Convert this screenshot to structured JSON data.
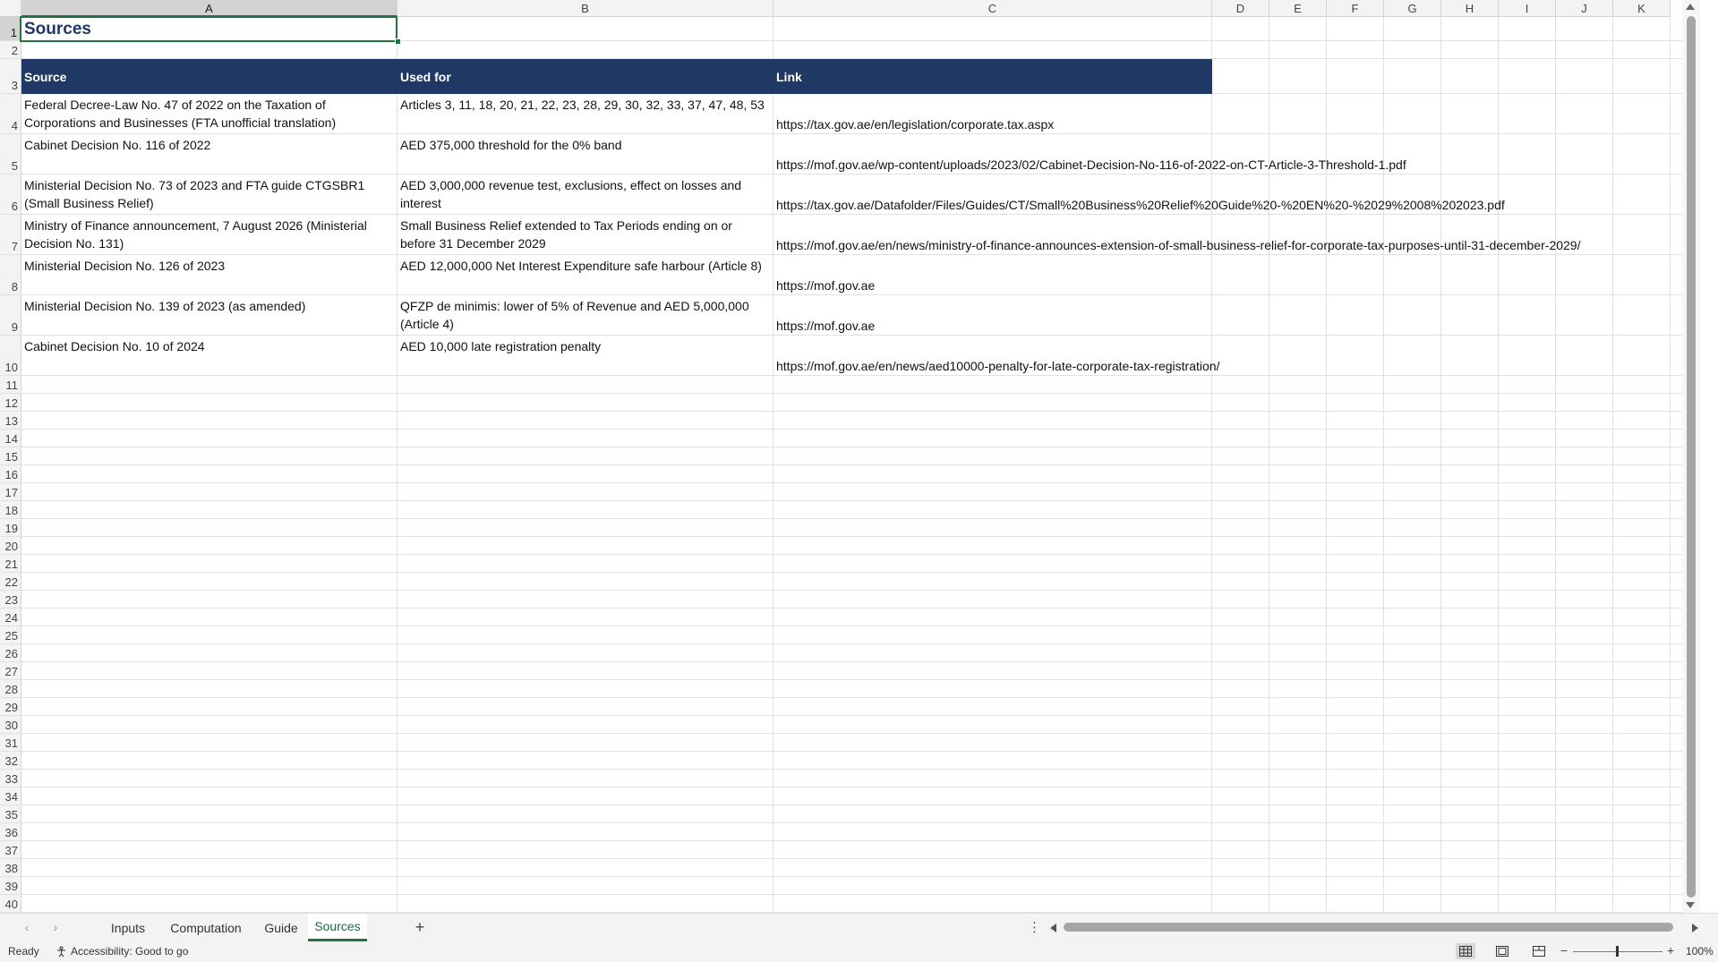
{
  "columns": [
    "A",
    "B",
    "C",
    "D",
    "E",
    "F",
    "G",
    "H",
    "I",
    "J",
    "K"
  ],
  "rows": [
    "1",
    "2",
    "3",
    "4",
    "5",
    "6",
    "7",
    "8",
    "9",
    "10",
    "11",
    "12",
    "13",
    "14",
    "15",
    "16",
    "17",
    "18",
    "19",
    "20",
    "21",
    "22",
    "23",
    "24",
    "25",
    "26",
    "27",
    "28",
    "29",
    "30",
    "31",
    "32",
    "33",
    "34",
    "35",
    "36",
    "37",
    "38",
    "39",
    "40"
  ],
  "active_cell": "A1",
  "sheet": {
    "title": "Sources",
    "headers": [
      "Source",
      "Used for",
      "Link"
    ],
    "rows": [
      {
        "source": "Federal Decree-Law No. 47 of 2022 on the Taxation of Corporations and Businesses (FTA unofficial translation)",
        "used_for": "Articles 3, 11, 18, 20, 21, 22, 23, 28, 29, 30, 32, 33, 37, 47, 48, 53",
        "link": "https://tax.gov.ae/en/legislation/corporate.tax.aspx"
      },
      {
        "source": "Cabinet Decision No. 116 of 2022",
        "used_for": "AED 375,000 threshold for the 0% band",
        "link": "https://mof.gov.ae/wp-content/uploads/2023/02/Cabinet-Decision-No-116-of-2022-on-CT-Article-3-Threshold-1.pdf"
      },
      {
        "source": "Ministerial Decision No. 73 of 2023 and FTA guide CTGSBR1 (Small Business Relief)",
        "used_for": "AED 3,000,000 revenue test, exclusions, effect on losses and interest",
        "link": "https://tax.gov.ae/Datafolder/Files/Guides/CT/Small%20Business%20Relief%20Guide%20-%20EN%20-%2029%2008%202023.pdf"
      },
      {
        "source": "Ministry of Finance announcement, 7 August 2026 (Ministerial Decision No. 131)",
        "used_for": "Small Business Relief extended to Tax Periods ending on or before 31 December 2029",
        "link": "https://mof.gov.ae/en/news/ministry-of-finance-announces-extension-of-small-business-relief-for-corporate-tax-purposes-until-31-december-2029/"
      },
      {
        "source": "Ministerial Decision No. 126 of 2023",
        "used_for": "AED 12,000,000 Net Interest Expenditure safe harbour (Article 8)",
        "link": "https://mof.gov.ae"
      },
      {
        "source": "Ministerial Decision No. 139 of 2023 (as amended)",
        "used_for": "QFZP de minimis: lower of 5% of Revenue and AED 5,000,000 (Article 4)",
        "link": "https://mof.gov.ae"
      },
      {
        "source": "Cabinet Decision No. 10 of 2024",
        "used_for": "AED 10,000 late registration penalty",
        "link": "https://mof.gov.ae/en/news/aed10000-penalty-for-late-corporate-tax-registration/"
      }
    ]
  },
  "tabs": [
    "Inputs",
    "Computation",
    "Guide",
    "Sources"
  ],
  "active_tab": "Sources",
  "add_sheet_label": "+",
  "tab_menu_label": "⋮",
  "nav_prev": "‹",
  "nav_next": "›",
  "status": {
    "ready": "Ready",
    "accessibility": "Accessibility: Good to go",
    "zoom": "100%",
    "zoom_minus": "−",
    "zoom_plus": "+"
  },
  "icons": {
    "accessibility": "accessibility-icon",
    "normal_view": "normal-view-icon",
    "page_layout": "page-layout-view-icon",
    "page_break": "page-break-view-icon"
  },
  "colors": {
    "header_fill": "#203864",
    "title_text": "#203864",
    "selection": "#217346"
  }
}
